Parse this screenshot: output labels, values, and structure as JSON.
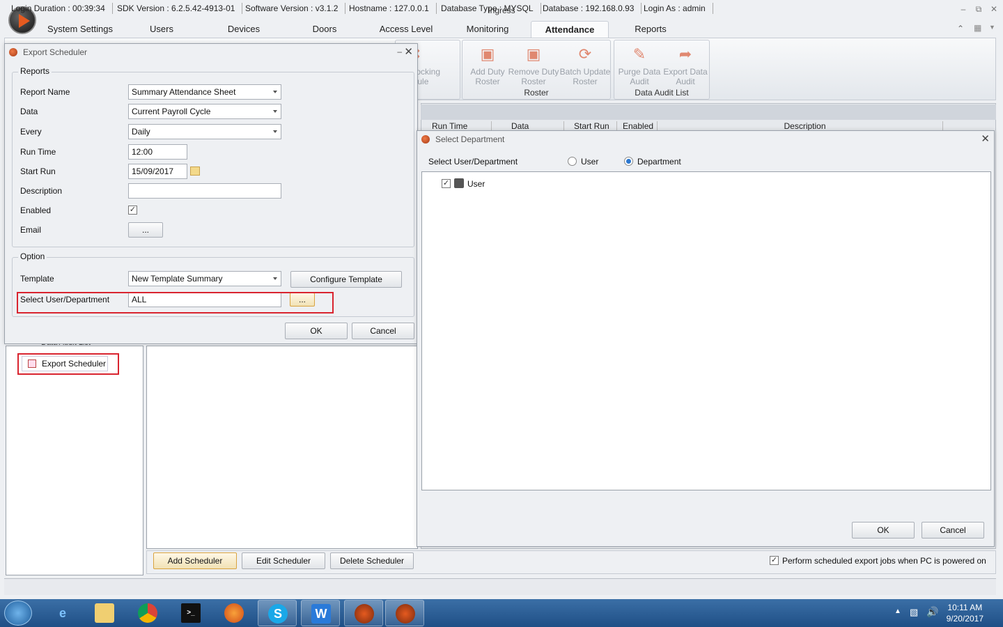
{
  "app": {
    "title": "Ingress"
  },
  "tabs": [
    "System Settings",
    "Users",
    "Devices",
    "Doors",
    "Access Level",
    "Monitoring",
    "Attendance",
    "Reports"
  ],
  "ribbon": {
    "partial_button": {
      "line1": "Clocking",
      "line2": "edule"
    },
    "roster_group": {
      "label": "Roster",
      "buttons": [
        {
          "line1": "Add Duty",
          "line2": "Roster"
        },
        {
          "line1": "Remove Duty",
          "line2": "Roster"
        },
        {
          "line1": "Batch Update",
          "line2": "Roster"
        }
      ]
    },
    "audit_group": {
      "label": "Data Audit List",
      "buttons": [
        {
          "line1": "Purge Data",
          "line2": "Audit"
        },
        {
          "line1": "Export Data",
          "line2": "Audit"
        }
      ]
    }
  },
  "grid": {
    "columns": [
      "Run Time",
      "Data",
      "Start Run",
      "Enabled",
      "Description"
    ]
  },
  "nav": {
    "partial_item": "Data Audit List",
    "export_scheduler": "Export Scheduler"
  },
  "bottom": {
    "add": "Add Scheduler",
    "edit": "Edit Scheduler",
    "delete": "Delete Scheduler",
    "perform_label": "Perform scheduled export jobs when PC is powered on",
    "perform_checked": true
  },
  "export_dialog": {
    "title": "Export Scheduler",
    "reports_legend": "Reports",
    "report_name_label": "Report Name",
    "report_name": "Summary Attendance Sheet",
    "data_label": "Data",
    "data": "Current Payroll Cycle",
    "every_label": "Every",
    "every": "Daily",
    "run_time_label": "Run Time",
    "run_time": "12:00",
    "start_run_label": "Start Run",
    "start_run": "15/09/2017",
    "description_label": "Description",
    "description": "",
    "enabled_label": "Enabled",
    "enabled": true,
    "email_label": "Email",
    "email_button": "...",
    "option_legend": "Option",
    "template_label": "Template",
    "template": "New Template Summary",
    "configure_template": "Configure Template",
    "select_label": "Select User/Department",
    "select_value": "ALL",
    "select_button": "...",
    "ok": "OK",
    "cancel": "Cancel"
  },
  "dept_dialog": {
    "title": "Select Department",
    "label": "Select User/Department",
    "radio_user": "User",
    "radio_department": "Department",
    "selected": "Department",
    "tree_item": "User",
    "tree_checked": true,
    "ok": "OK",
    "cancel": "Cancel"
  },
  "status": [
    "Login Duration : 00:39:34",
    "SDK Version : 6.2.5.42-4913-01",
    "Software Version : v3.1.2",
    "Hostname : 127.0.0.1",
    "Database Type : MYSQL",
    "Database : 192.168.0.93",
    "Login As : admin"
  ],
  "taskbar": {
    "time": "10:11 AM",
    "date": "9/20/2017"
  },
  "colors": {
    "highlight_red": "#d9242f",
    "accent_orange": "#e55a1f",
    "taskbar": "#2a5a92"
  }
}
